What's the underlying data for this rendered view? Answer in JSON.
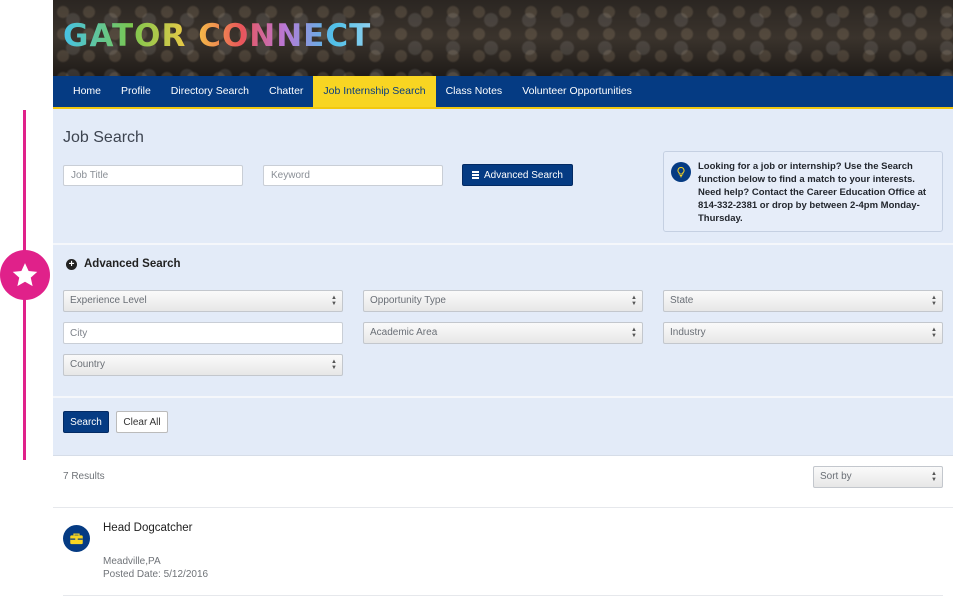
{
  "banner": {
    "title": "GATOR CONNECT"
  },
  "nav": {
    "items": [
      {
        "label": "Home"
      },
      {
        "label": "Profile"
      },
      {
        "label": "Directory Search"
      },
      {
        "label": "Chatter"
      },
      {
        "label": "Job Internship Search",
        "active": true
      },
      {
        "label": "Class Notes"
      },
      {
        "label": "Volunteer Opportunities"
      }
    ]
  },
  "search": {
    "title": "Job Search",
    "job_title_placeholder": "Job Title",
    "keyword_placeholder": "Keyword",
    "advanced_button": "Advanced Search",
    "info_text": "Looking for a job or internship? Use the Search function below to find a match to your interests. Need help? Contact the Career Education Office at 814-332-2381 or drop by between 2-4pm Monday-Thursday.",
    "info_icon": "lightbulb-icon"
  },
  "advanced": {
    "heading": "Advanced Search",
    "experience_level": "Experience Level",
    "opportunity_type": "Opportunity Type",
    "state": "State",
    "city_placeholder": "City",
    "academic_area": "Academic Area",
    "industry": "Industry",
    "country": "Country"
  },
  "actions": {
    "search_label": "Search",
    "clear_label": "Clear All"
  },
  "results": {
    "count_text": "7 Results",
    "sort_label": "Sort by",
    "items": [
      {
        "title": "Head Dogcatcher",
        "location": "Meadville,PA",
        "posted": "Posted Date: 5/12/2016",
        "icon": "briefcase-icon"
      }
    ]
  },
  "colors": {
    "navy": "#053b83",
    "gold": "#f8d522",
    "panel": "#e3ebf8",
    "accent": "#e0218a"
  }
}
